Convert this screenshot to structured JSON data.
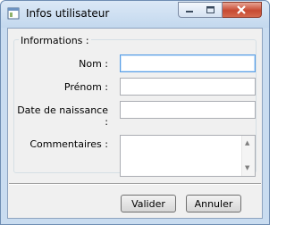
{
  "window": {
    "title": "Infos utilisateur",
    "minimize_glyph": "–",
    "maximize_glyph": "□",
    "close_glyph": "✕"
  },
  "form": {
    "group_title": "Informations :",
    "fields": {
      "nom": {
        "label": "Nom :",
        "value": ""
      },
      "prenom": {
        "label": "Prénom :",
        "value": ""
      },
      "date_naissance": {
        "label": "Date de naissance :",
        "value": ""
      },
      "commentaires": {
        "label": "Commentaires :",
        "value": ""
      }
    }
  },
  "buttons": {
    "valider": "Valider",
    "annuler": "Annuler"
  },
  "icons": {
    "app": "window-icon",
    "scroll_up": "scroll-up-arrow-icon",
    "scroll_down": "scroll-down-arrow-icon"
  }
}
